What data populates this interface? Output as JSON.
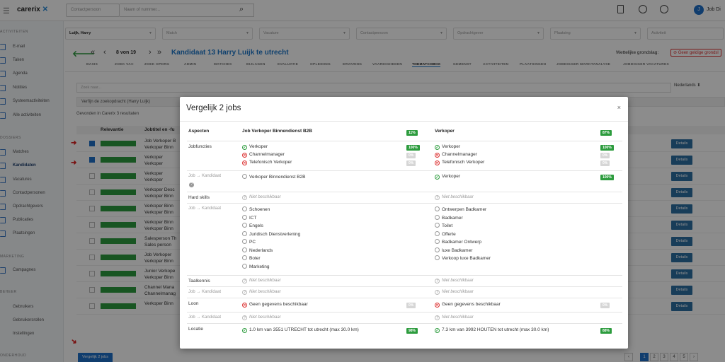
{
  "app": {
    "logo_text": "carerix",
    "logo_mark": "✕",
    "search_select_label": "Contactpersoon",
    "search_placeholder": "Naam of nummer...",
    "user_initial": "J",
    "user_name": "Job Di"
  },
  "sidebar": {
    "sections": [
      {
        "title": "ACTIVITEITEN",
        "items": [
          "E-mail",
          "Taken",
          "Agenda",
          "Notities",
          "Systeemactiviteiten",
          "Alle activiteiten"
        ]
      },
      {
        "title": "DOSSIERS",
        "items": [
          "Matches",
          "Kandidaten",
          "Vacatures",
          "Contactpersonen",
          "Opdrachtgevers",
          "Publicaties",
          "Plaatsingen"
        ]
      },
      {
        "title": "MARKETING",
        "items": [
          "Campagnes"
        ]
      },
      {
        "title": "BEHEER",
        "items": [
          "Gebruikers",
          "Gebruikersrollen",
          "Instellingen"
        ]
      },
      {
        "title": "ONDERHOUD",
        "items": []
      }
    ],
    "active": "Kandidaten"
  },
  "filters": [
    "Luijk, Harry",
    "Match",
    "Vacature",
    "Contactpersoon",
    "Opdrachtgever",
    "Plaatsing",
    "Activiteit"
  ],
  "record": {
    "pager": "8 von 19",
    "title": "Kandidaat 13 Harry Luijk te utrecht",
    "legal_label": "Wettelijke grondslag:",
    "legal_badge": "Geen geldige grondsl",
    "tabs": [
      "BASIS",
      "ZOEK VAC",
      "ZOEK OPDRG",
      "ADMIN",
      "MATCHES",
      "BIJLAGEN",
      "EVALUATIE",
      "OPLEIDING",
      "ERVARING",
      "VAARDIGHEDEN",
      "THEMATCHBOX",
      "GEMENST",
      "ACTIVITEITEN",
      "PLAATSINGEN",
      "JOBDIGGER MARKTANALYSE",
      "JOBDIGGER VACATURES"
    ],
    "active_tab": "THEMATCHBOX"
  },
  "background": {
    "search_placeholder": "Zoek naar...",
    "language": "Nederlands",
    "filter_chip": "Verfijn de zoekopdracht (Harry Luijk)",
    "found_in": "Gevonden in",
    "found_source": "Carerix",
    "found_count": "3 resultaten",
    "col_relevance": "Relevantie",
    "col_jobtitle": "Jobtitel en -fu",
    "rows": [
      {
        "title": "Job Verkoper B",
        "sub": "Verkoper Binn",
        "checked": true
      },
      {
        "title": "Verkoper",
        "sub": "Verkoper",
        "checked": true
      },
      {
        "title": "Verkoper",
        "sub": "Verkoper",
        "checked": false
      },
      {
        "title": "Verkoper Desc",
        "sub": "Verkoper Binn",
        "checked": false
      },
      {
        "title": "Verkoper Binn",
        "sub": "Verkoper Binn",
        "checked": false
      },
      {
        "title": "Verkoper Binn",
        "sub": "Verkoper Binn",
        "checked": false
      },
      {
        "title": "Salesperson Th",
        "sub": "Sales person",
        "checked": false
      },
      {
        "title": "Job Verkoper",
        "sub": "Verkoper Binn",
        "checked": false
      },
      {
        "title": "Junior Verkope",
        "sub": "Verkoper Binn",
        "checked": false
      },
      {
        "title": "Channel Mana",
        "sub": "Channelmanag",
        "checked": false
      },
      {
        "title": "Verkoper Binn",
        "sub": "",
        "checked": false
      }
    ],
    "detail_label": "Details",
    "compare_button": "Vergelijk 2 jobs",
    "pages": [
      "1",
      "2",
      "3",
      "4",
      "5"
    ]
  },
  "modal": {
    "title": "Vergelijk 2 jobs",
    "close": "×",
    "col_aspects": "Aspecten",
    "job1_name": "Job Verkoper Binnendienst B2B",
    "job1_pct": "11%",
    "job2_name": "Verkoper",
    "job2_pct": "87%",
    "not_available": "Niet beschikbaar",
    "sections": {
      "jobfuncties": {
        "label": "Jobfuncties",
        "job1": [
          {
            "text": "Verkoper",
            "status": "ok",
            "pct": "100%"
          },
          {
            "text": "Channelmanager",
            "status": "no",
            "pct": "0%"
          },
          {
            "text": "Telefonisch Verkoper",
            "status": "no",
            "pct": "0%"
          }
        ],
        "job2": [
          {
            "text": "Verkoper",
            "status": "ok",
            "pct": "100%"
          },
          {
            "text": "Channelmanager",
            "status": "no",
            "pct": "0%"
          },
          {
            "text": "Telefonisch Verkoper",
            "status": "no",
            "pct": "0%"
          }
        ]
      },
      "job_kandidaat_1": {
        "label": "Job → Kandidaat",
        "job1": [
          {
            "text": "Verkoper Binnendienst B2B",
            "status": "none"
          }
        ],
        "job2": [
          {
            "text": "Verkoper",
            "status": "ok",
            "pct": "100%"
          }
        ]
      },
      "hardskills": {
        "label": "Hard skills"
      },
      "job_kandidaat_2": {
        "label": "Job → Kandidaat",
        "job1": [
          "Schoenen",
          "ICT",
          "Engels",
          "Juridisch Dienstverlening",
          "PC",
          "Nederlands",
          "Boter",
          "Marketing"
        ],
        "job2": [
          "Ontwerpen Badkamer",
          "Badkamer",
          "Toilet",
          "Offerte",
          "Badkamer Ontwerp",
          "luxe Badkamer",
          "Verkoop luxe Badkamer"
        ]
      },
      "taalkennis": {
        "label": "Taalkennis"
      },
      "job_kandidaat_3": {
        "label": "Job → Kandidaat"
      },
      "loon": {
        "label": "Loon",
        "job1": {
          "text": "Geen gegevens beschikbaar",
          "pct": "0%"
        },
        "job2": {
          "text": "Geen gegevens beschikbaar",
          "pct": "0%"
        }
      },
      "job_kandidaat_4": {
        "label": "Job → Kandidaat"
      },
      "locatie": {
        "label": "Locatie",
        "job1": {
          "text": "1.0 km van 3551 UTRECHT tot utrecht (max 30.0 km)",
          "pct": "98%"
        },
        "job2": {
          "text": "7.3 km van 3992 HOUTEN tot utrecht (max 30.0 km)",
          "pct": "88%"
        }
      }
    }
  }
}
